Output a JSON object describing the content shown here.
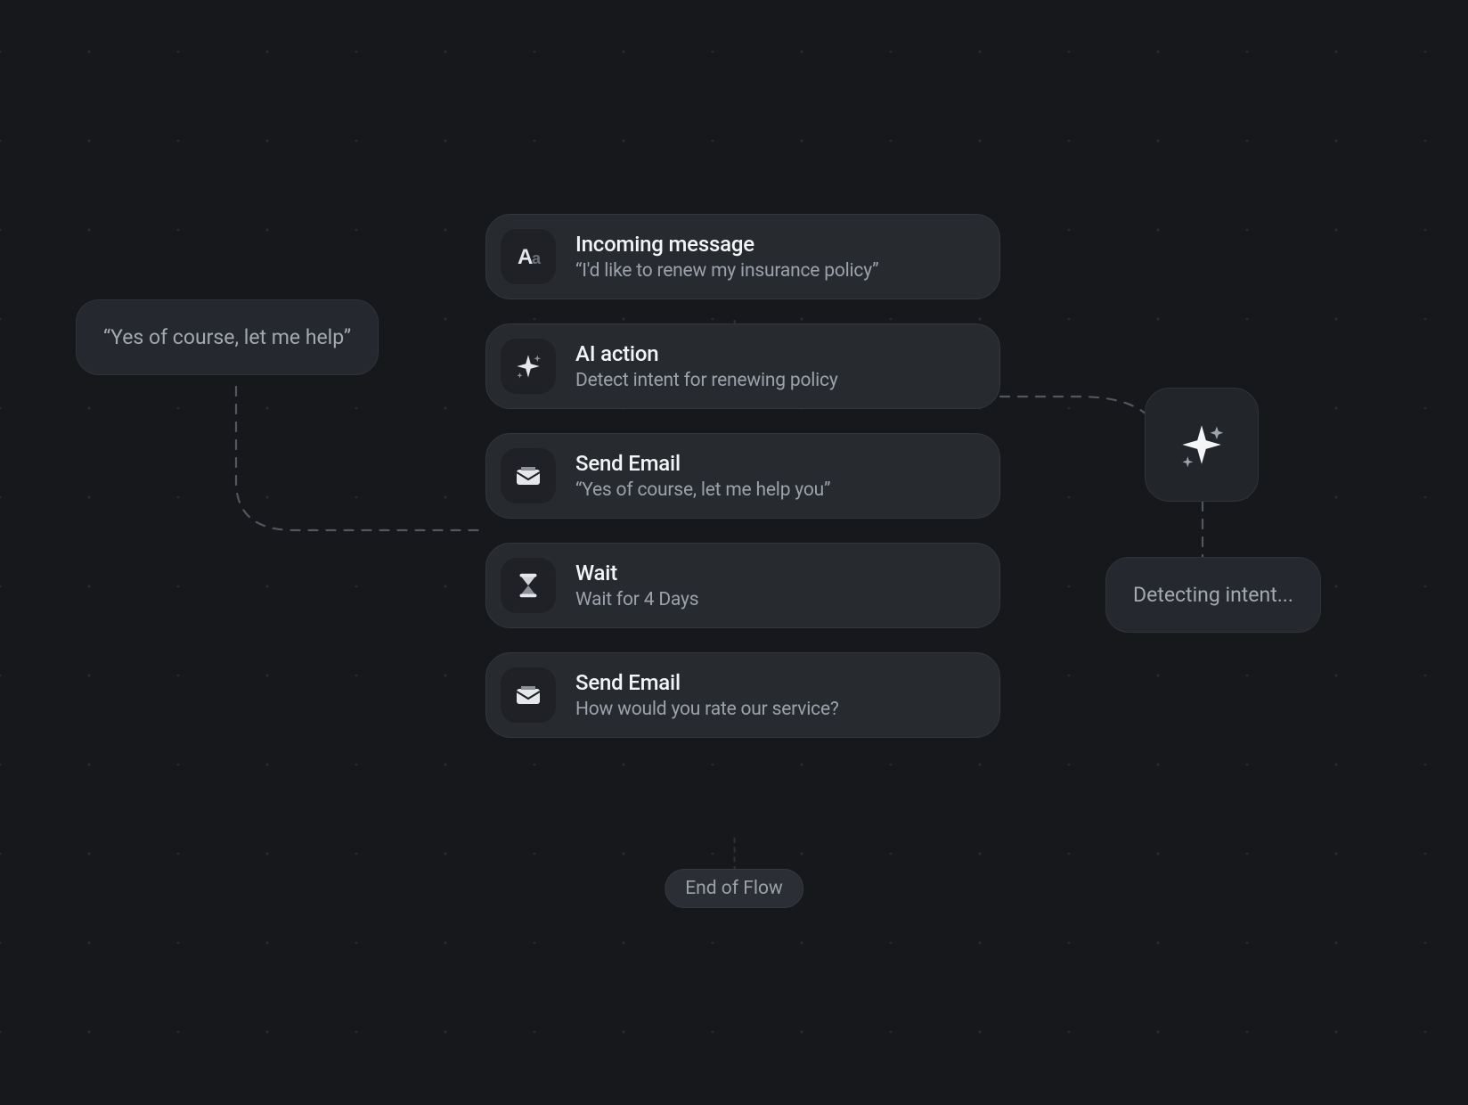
{
  "flow": {
    "steps": [
      {
        "icon": "text",
        "title": "Incoming message",
        "subtitle": "“I'd like to renew my insurance policy”"
      },
      {
        "icon": "sparkle",
        "title": "AI action",
        "subtitle": "Detect intent for renewing policy"
      },
      {
        "icon": "email",
        "title": "Send Email",
        "subtitle": "“Yes of course, let me help you”"
      },
      {
        "icon": "hourglass",
        "title": "Wait",
        "subtitle": "Wait for 4 Days"
      },
      {
        "icon": "email",
        "title": "Send Email",
        "subtitle": "How would you rate our service?"
      }
    ],
    "end_label": "End of Flow"
  },
  "left_bubble": {
    "text": "“Yes of course, let me help”"
  },
  "right_node": {
    "icon": "sparkle"
  },
  "right_bubble": {
    "text": "Detecting intent..."
  },
  "colors": {
    "bg": "#16181c",
    "card": "#272a2f",
    "border": "#33363c",
    "text_primary": "#f3f4f6",
    "text_secondary": "#9ca1ab"
  }
}
